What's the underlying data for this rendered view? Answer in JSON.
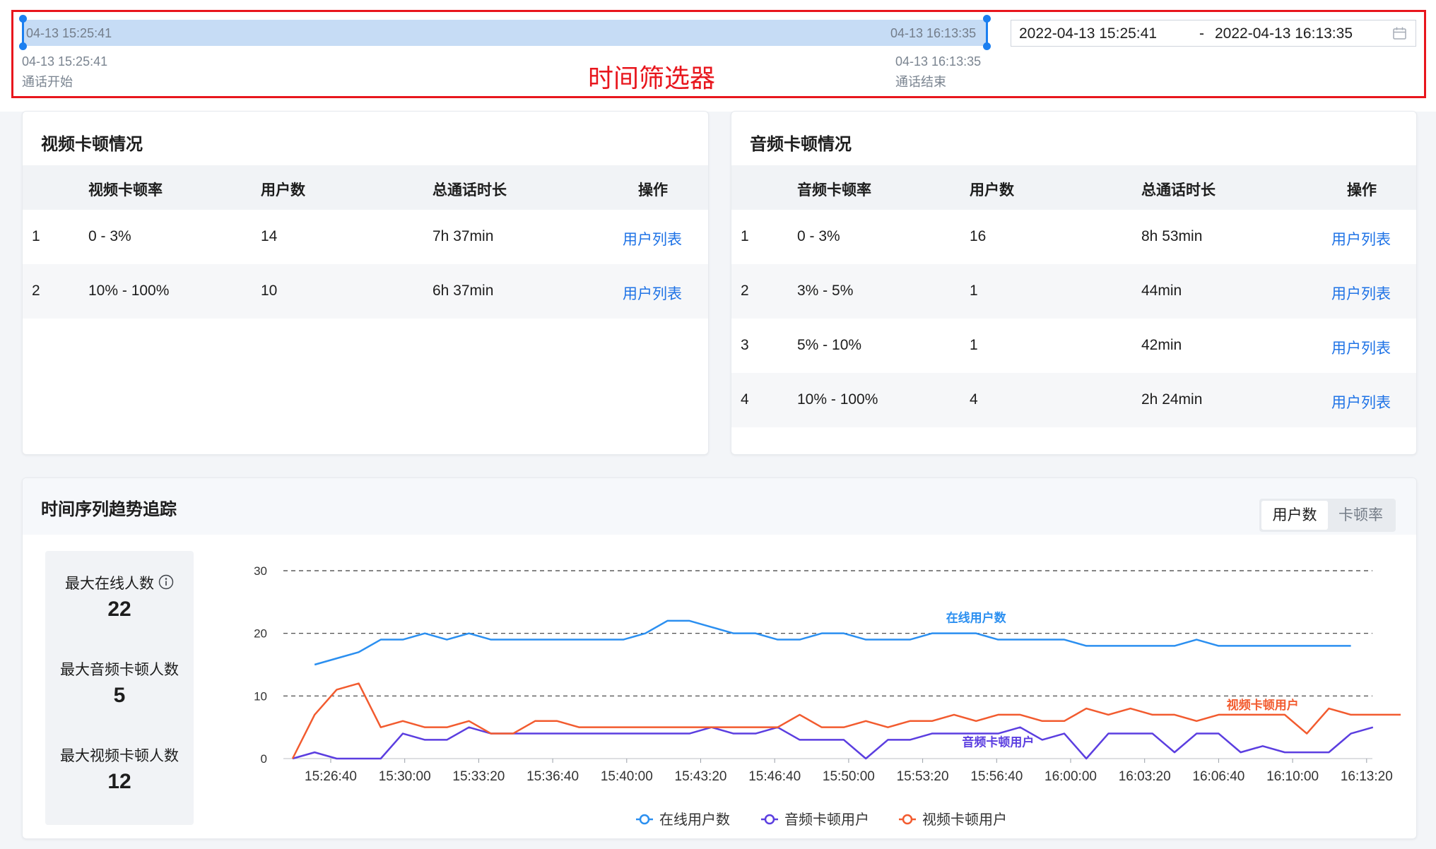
{
  "filter": {
    "track_start": "04-13 15:25:41",
    "track_end": "04-13 16:13:35",
    "start_time": "04-13 15:25:41",
    "start_label": "通话开始",
    "end_time": "04-13 16:13:35",
    "end_label": "通话结束",
    "caption": "时间筛选器",
    "date_from": "2022-04-13 15:25:41",
    "date_separator": "-",
    "date_to": "2022-04-13 16:13:35",
    "calendar_icon": "calendar-icon"
  },
  "video_stall": {
    "title": "视频卡顿情况",
    "headers": [
      "视频卡顿率",
      "用户数",
      "总通话时长",
      "操作"
    ],
    "rows": [
      {
        "index": "1",
        "rate": "0 - 3%",
        "users": "14",
        "duration": "7h 37min",
        "action": "用户列表"
      },
      {
        "index": "2",
        "rate": "10% - 100%",
        "users": "10",
        "duration": "6h 37min",
        "action": "用户列表"
      }
    ]
  },
  "audio_stall": {
    "title": "音频卡顿情况",
    "headers": [
      "音频卡顿率",
      "用户数",
      "总通话时长",
      "操作"
    ],
    "rows": [
      {
        "index": "1",
        "rate": "0 - 3%",
        "users": "16",
        "duration": "8h 53min",
        "action": "用户列表"
      },
      {
        "index": "2",
        "rate": "3% - 5%",
        "users": "1",
        "duration": "44min",
        "action": "用户列表"
      },
      {
        "index": "3",
        "rate": "5% - 10%",
        "users": "1",
        "duration": "42min",
        "action": "用户列表"
      },
      {
        "index": "4",
        "rate": "10% - 100%",
        "users": "4",
        "duration": "2h 24min",
        "action": "用户列表"
      }
    ]
  },
  "trend": {
    "title": "时间序列趋势追踪",
    "tabs": [
      "用户数",
      "卡顿率"
    ],
    "active_tab": "用户数",
    "stats": [
      {
        "label": "最大在线人数",
        "value": "22"
      },
      {
        "label": "最大音频卡顿人数",
        "value": "5"
      },
      {
        "label": "最大视频卡顿人数",
        "value": "12"
      }
    ],
    "info_icon": "info-icon"
  },
  "chart_data": {
    "type": "line",
    "x_ticks": [
      "15:26:40",
      "15:30:00",
      "15:33:20",
      "15:36:40",
      "15:40:00",
      "15:43:20",
      "15:46:40",
      "15:50:00",
      "15:53:20",
      "15:56:40",
      "16:00:00",
      "16:03:20",
      "16:06:40",
      "16:10:00",
      "16:13:20"
    ],
    "y_ticks": [
      0,
      10,
      20,
      30
    ],
    "ylim": [
      0,
      30
    ],
    "grid": "dashed-horizontal",
    "legend_position": "bottom",
    "series": [
      {
        "name": "在线用户数",
        "color": "#2b8ff0",
        "label_position": "mid",
        "values": [
          null,
          15,
          16,
          17,
          19,
          19,
          20,
          19,
          20,
          19,
          19,
          19,
          19,
          19,
          19,
          19,
          20,
          22,
          22,
          21,
          20,
          20,
          19,
          19,
          20,
          20,
          19,
          19,
          19,
          20,
          20,
          20,
          19,
          19,
          19,
          19,
          18,
          18,
          18,
          18,
          18,
          19,
          18,
          18,
          18,
          18,
          18,
          18,
          18
        ]
      },
      {
        "name": "音频卡顿用户",
        "color": "#5b3ee0",
        "label_position": "mid-low",
        "values": [
          0,
          1,
          0,
          0,
          0,
          4,
          3,
          3,
          5,
          4,
          4,
          4,
          4,
          4,
          4,
          4,
          4,
          4,
          4,
          5,
          4,
          4,
          5,
          3,
          3,
          3,
          0,
          3,
          3,
          4,
          4,
          4,
          4,
          5,
          3,
          4,
          0,
          4,
          4,
          4,
          1,
          4,
          4,
          1,
          2,
          1,
          1,
          1,
          4,
          5
        ]
      },
      {
        "name": "视频卡顿用户",
        "color": "#f25b2f",
        "label_position": "right",
        "values": [
          0,
          7,
          11,
          12,
          5,
          6,
          5,
          5,
          6,
          4,
          4,
          6,
          6,
          5,
          5,
          5,
          5,
          5,
          5,
          5,
          5,
          5,
          5,
          7,
          5,
          5,
          6,
          5,
          6,
          6,
          7,
          6,
          7,
          7,
          6,
          6,
          8,
          7,
          8,
          7,
          7,
          6,
          7,
          7,
          7,
          7,
          4,
          8,
          7,
          7,
          7,
          7
        ]
      }
    ]
  }
}
